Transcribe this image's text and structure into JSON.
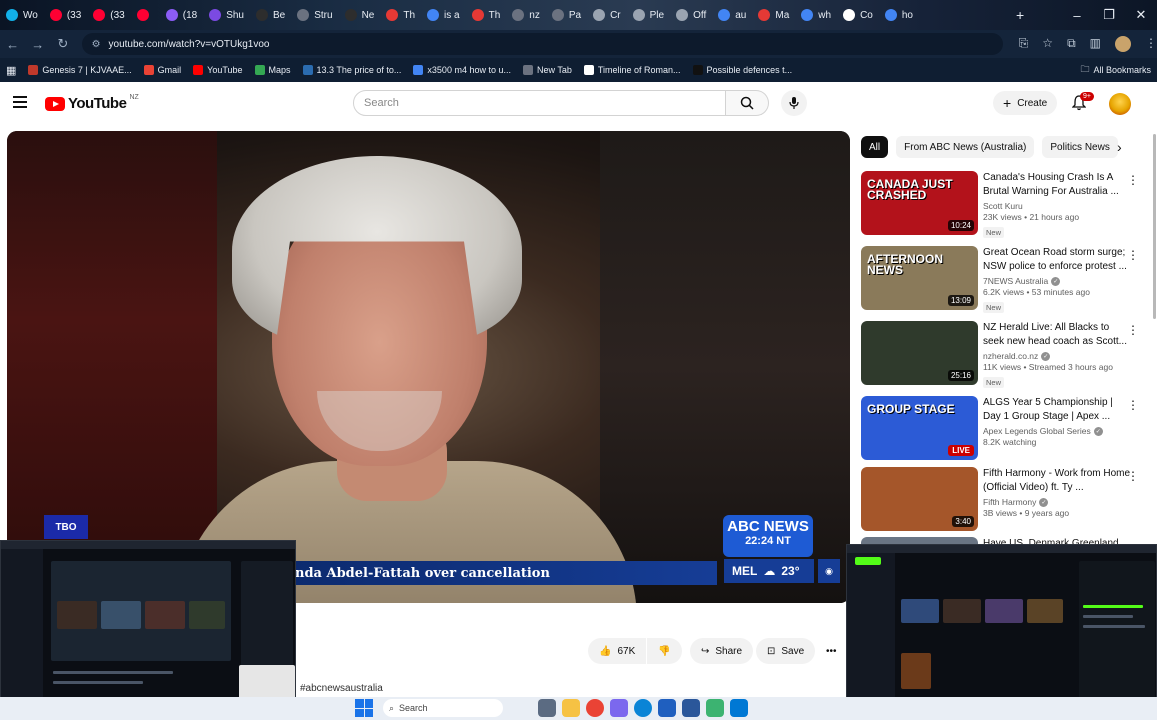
{
  "browser": {
    "tabs": [
      {
        "label": "Wo",
        "color": "#12b0e8"
      },
      {
        "label": "(33",
        "color": "#ff0033"
      },
      {
        "label": "(33",
        "color": "#ff0033"
      },
      {
        "label": "",
        "color": "#ff0033"
      },
      {
        "label": "(18",
        "color": "#8b5cf6"
      },
      {
        "label": "Shu",
        "color": "#7b4ae2"
      },
      {
        "label": "Be",
        "color": "#2d2d2d"
      },
      {
        "label": "Stru",
        "color": "#6b7280"
      },
      {
        "label": "Ne",
        "color": "#2d2d2d"
      },
      {
        "label": "Th",
        "color": "#e53935"
      },
      {
        "label": "is a",
        "color": "#4285f4"
      },
      {
        "label": "Th",
        "color": "#e53935"
      },
      {
        "label": "nz",
        "color": "#6b7280"
      },
      {
        "label": "Pa",
        "color": "#6b7280"
      },
      {
        "label": "Cr",
        "color": "#9aa4b1"
      },
      {
        "label": "Ple",
        "color": "#9aa4b1"
      },
      {
        "label": "Off",
        "color": "#9aa4b1"
      },
      {
        "label": "au",
        "color": "#4285f4"
      },
      {
        "label": "Ma",
        "color": "#e53935"
      },
      {
        "label": "wh",
        "color": "#4285f4"
      },
      {
        "label": "Co",
        "color": "#ffffff"
      },
      {
        "label": "ho",
        "color": "#4285f4"
      }
    ],
    "new_tab": "+",
    "window_controls": {
      "minimize": "–",
      "restore": "❐",
      "close": "✕"
    },
    "url": "youtube.com/watch?v=vOTUkg1voo",
    "bookmarks": [
      {
        "label": "Genesis 7 | KJVAAE...",
        "color": "#c0392b"
      },
      {
        "label": "Gmail",
        "color": "#ea4335"
      },
      {
        "label": "YouTube",
        "color": "#ff0000"
      },
      {
        "label": "Maps",
        "color": "#34a853"
      },
      {
        "label": "13.3 The price of to...",
        "color": "#2b6cb0"
      },
      {
        "label": "x3500 m4 how to u...",
        "color": "#4285f4"
      },
      {
        "label": "New Tab",
        "color": "#6b7280"
      },
      {
        "label": "Timeline of Roman...",
        "color": "#ffffff"
      },
      {
        "label": "Possible defences t...",
        "color": "#111111"
      }
    ],
    "all_bookmarks": "All Bookmarks"
  },
  "youtube": {
    "logo_word": "YouTube",
    "region": "NZ",
    "search_placeholder": "Search",
    "create_label": "Create",
    "notif_count": "9+",
    "video": {
      "ticker": "nda Abdel-Fattah over cancellation",
      "news_brand": "ABC NEWS",
      "news_time": "22:24 NT",
      "weather_city": "MEL",
      "weather_temp": "23°",
      "badge": "TBO"
    },
    "actions": {
      "likes": "67K",
      "share": "Share",
      "save": "Save",
      "more": "•••"
    },
    "hashtag": "#abcnewsaustralia",
    "chips": [
      {
        "label": "All",
        "active": true
      },
      {
        "label": "From ABC News (Australia)",
        "active": false
      },
      {
        "label": "Politics News",
        "active": false
      }
    ],
    "recommendations": [
      {
        "title": "Canada's Housing Crash Is A Brutal Warning For Australia ...",
        "channel": "Scott Kuru",
        "verified": false,
        "stats": "23K views • 21 hours ago",
        "badge": "New",
        "duration": "10:24",
        "thumb_text": "CANADA JUST CRASHED",
        "thumb_color": "#b3121b"
      },
      {
        "title": "Great Ocean Road storm surge; NSW police to enforce protest ...",
        "channel": "7NEWS Australia",
        "verified": true,
        "stats": "6.2K views • 53 minutes ago",
        "badge": "New",
        "duration": "13:09",
        "thumb_text": "AFTERNOON NEWS",
        "thumb_color": "#8a7a5a"
      },
      {
        "title": "NZ Herald Live: All Blacks to seek new head coach as Scott...",
        "channel": "nzherald.co.nz",
        "verified": true,
        "stats": "11K views • Streamed 3 hours ago",
        "badge": "New",
        "duration": "25:16",
        "thumb_text": "",
        "thumb_color": "#2f3a2c"
      },
      {
        "title": "ALGS Year 5 Championship | Day 1 Group Stage | Apex ...",
        "channel": "Apex Legends Global Series",
        "verified": true,
        "stats": "8.2K watching",
        "badge": "",
        "duration": "",
        "live": "LIVE",
        "thumb_text": "GROUP STAGE",
        "thumb_color": "#2c5bd6"
      },
      {
        "title": "Fifth Harmony - Work from Home (Official Video) ft. Ty ...",
        "channel": "Fifth Harmony",
        "verified": true,
        "stats": "3B views • 9 years ago",
        "badge": "",
        "duration": "3:40",
        "thumb_text": "",
        "thumb_color": "#a5562a"
      },
      {
        "title": "Have US, Denmark Greenland",
        "channel": "",
        "verified": false,
        "stats": "",
        "badge": "",
        "duration": "",
        "thumb_text": "",
        "thumb_color": "#6a7584"
      }
    ]
  },
  "taskbar": {
    "search_label": "Search"
  }
}
